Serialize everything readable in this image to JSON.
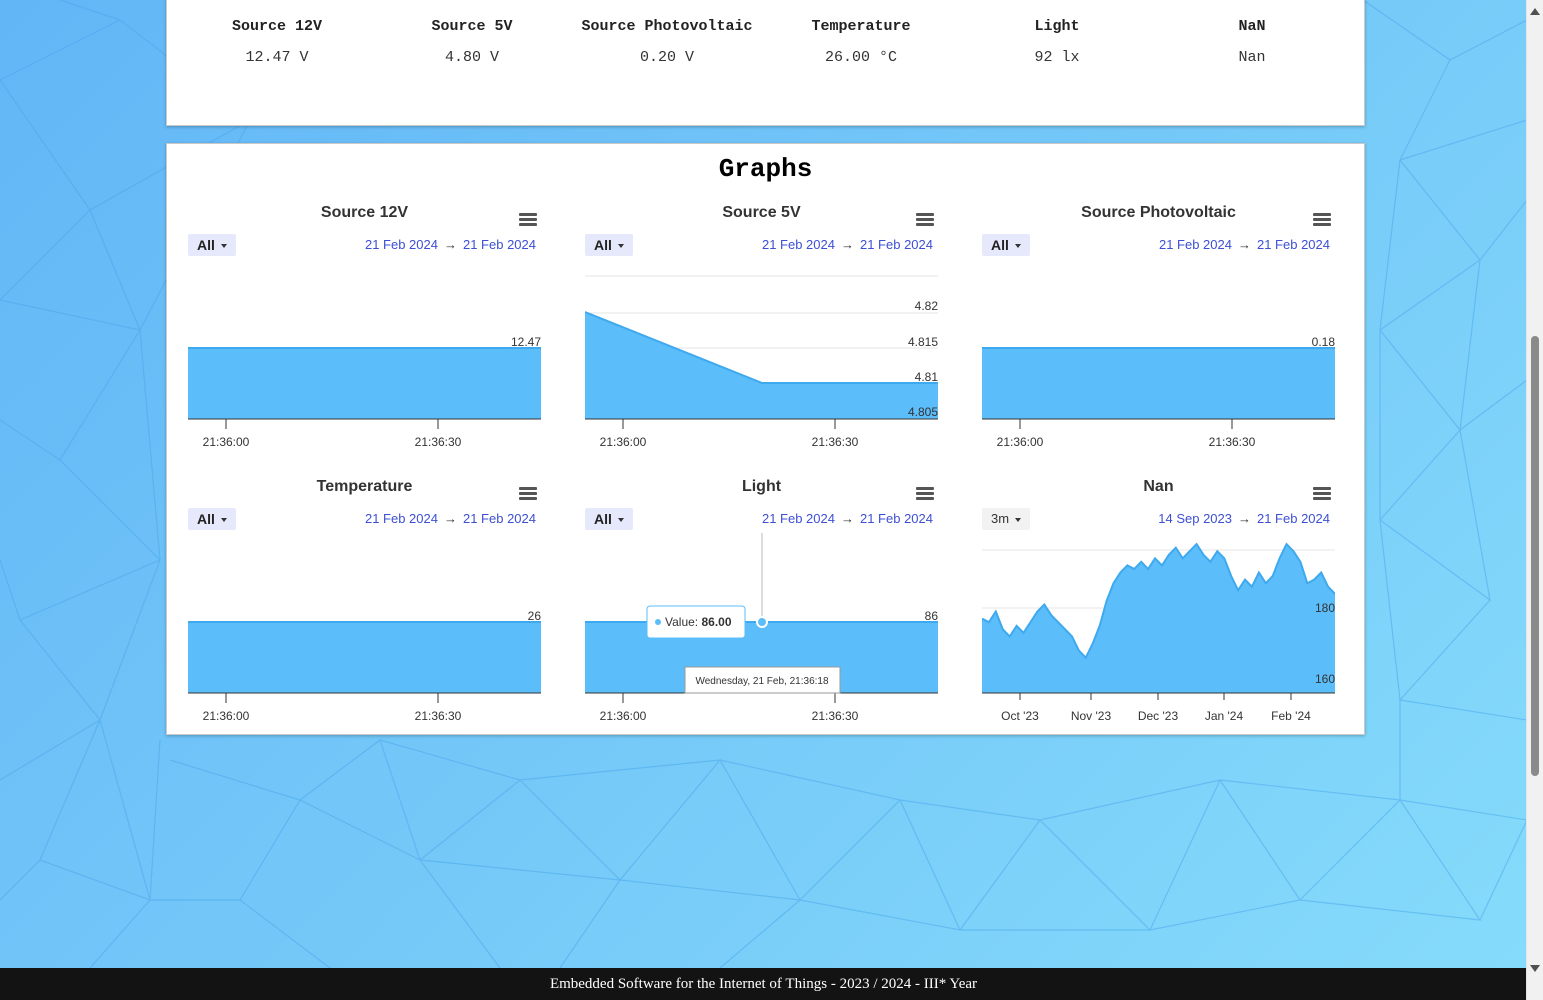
{
  "sensors": [
    {
      "name": "Source 12V",
      "value": "12.47 V"
    },
    {
      "name": "Source 5V",
      "value": "4.80 V"
    },
    {
      "name": "Source Photovoltaic",
      "value": "0.20 V"
    },
    {
      "name": "Temperature",
      "value": "26.00 °C"
    },
    {
      "name": "Light",
      "value": "92 lx"
    },
    {
      "name": "NaN",
      "value": "Nan"
    }
  ],
  "graphs": {
    "title": "Graphs",
    "arrow": "→",
    "charts": [
      {
        "title": "Source 12V",
        "range": "All",
        "from": "21 Feb 2024",
        "to": "21 Feb 2024"
      },
      {
        "title": "Source 5V",
        "range": "All",
        "from": "21 Feb 2024",
        "to": "21 Feb 2024"
      },
      {
        "title": "Source Photovoltaic",
        "range": "All",
        "from": "21 Feb 2024",
        "to": "21 Feb 2024"
      },
      {
        "title": "Temperature",
        "range": "All",
        "from": "21 Feb 2024",
        "to": "21 Feb 2024"
      },
      {
        "title": "Light",
        "range": "All",
        "from": "21 Feb 2024",
        "to": "21 Feb 2024"
      },
      {
        "title": "Nan",
        "range": "3m",
        "from": "14 Sep 2023",
        "to": "21 Feb 2024"
      }
    ]
  },
  "chart_data": [
    {
      "type": "area",
      "title": "Source 12V",
      "x": [
        "21:36:00",
        "21:36:30"
      ],
      "values": [
        12.47,
        12.47
      ],
      "last_label": "12.47",
      "color": "#5bbdf9"
    },
    {
      "type": "area",
      "title": "Source 5V",
      "x": [
        "21:36:00",
        "21:36:30"
      ],
      "values": [
        4.82,
        4.81,
        4.81
      ],
      "ytick_labels": [
        "4.82",
        "4.815",
        "4.81",
        "4.805"
      ],
      "ylim": [
        4.805,
        4.82
      ],
      "color": "#5bbdf9"
    },
    {
      "type": "area",
      "title": "Source Photovoltaic",
      "x": [
        "21:36:00",
        "21:36:30"
      ],
      "values": [
        0.18,
        0.18
      ],
      "last_label": "0.18",
      "color": "#5bbdf9"
    },
    {
      "type": "area",
      "title": "Temperature",
      "x": [
        "21:36:00",
        "21:36:30"
      ],
      "values": [
        26,
        26
      ],
      "last_label": "26",
      "color": "#5bbdf9"
    },
    {
      "type": "area",
      "title": "Light",
      "x": [
        "21:36:00",
        "21:36:30"
      ],
      "values": [
        86,
        86
      ],
      "last_label": "86",
      "color": "#5bbdf9",
      "tooltip": {
        "label": "Value:",
        "value": "86.00",
        "time": "Wednesday, 21 Feb, 21:36:18"
      }
    },
    {
      "type": "area",
      "title": "Nan",
      "x": [
        "Oct '23",
        "Nov '23",
        "Dec '23",
        "Jan '24",
        "Feb '24"
      ],
      "ytick_labels": [
        "180",
        "160"
      ],
      "ylim": [
        160,
        180
      ],
      "color": "#5bbdf9",
      "values": [
        177,
        176,
        179,
        174,
        172,
        175,
        173,
        176,
        179,
        181,
        178,
        176,
        174,
        172,
        168,
        166,
        170,
        175,
        182,
        187,
        190,
        192,
        191,
        193,
        191,
        194,
        192,
        195,
        197,
        194,
        196,
        198,
        195,
        193,
        196,
        194,
        189,
        185,
        188,
        186,
        190,
        187,
        189,
        194,
        198,
        196,
        193,
        187,
        188,
        190,
        186,
        184
      ]
    }
  ],
  "footer": "Embedded Software for the Internet of Things - 2023 / 2024 - III* Year"
}
